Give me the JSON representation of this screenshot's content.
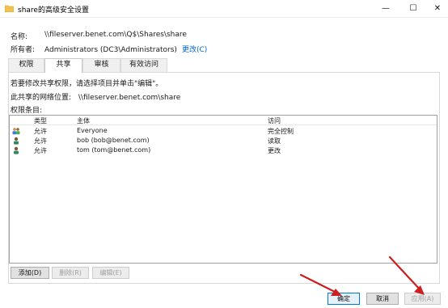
{
  "window": {
    "title": "share的高级安全设置",
    "minimize_glyph": "—",
    "maximize_glyph": "☐",
    "close_glyph": "✕"
  },
  "fields": {
    "name_label": "名称:",
    "name_value": "\\\\fileserver.benet.com\\Q$\\Shares\\share",
    "owner_label": "所有者:",
    "owner_value": "Administrators (DC3\\Administrators)",
    "owner_change": "更改(C)"
  },
  "tabs": [
    {
      "label": "权限"
    },
    {
      "label": "共享"
    },
    {
      "label": "审核"
    },
    {
      "label": "有效访问"
    }
  ],
  "share_tab": {
    "instruction": "若要修改共享权限，请选择项目并单击\"编辑\"。",
    "network_location_label": "此共享的网络位置:",
    "network_location_value": "\\\\fileserver.benet.com\\share",
    "entries_label": "权限条目:"
  },
  "permissions": {
    "columns": [
      "类型",
      "主体",
      "访问"
    ],
    "rows": [
      {
        "icon": "group-icon",
        "type": "允许",
        "principal": "Everyone",
        "access": "完全控制"
      },
      {
        "icon": "user-icon",
        "type": "允许",
        "principal": "bob (bob@benet.com)",
        "access": "读取"
      },
      {
        "icon": "user-icon",
        "type": "允许",
        "principal": "tom (tom@benet.com)",
        "access": "更改"
      }
    ]
  },
  "actions": {
    "add": "添加(D)",
    "remove": "删除(R)",
    "edit": "编辑(E)"
  },
  "footer": {
    "ok": "确定",
    "cancel": "取消",
    "apply": "应用(A)"
  },
  "colors": {
    "link": "#0066cc",
    "annotation_arrow": "#cc1f1f",
    "folder": "#f2c14e"
  }
}
